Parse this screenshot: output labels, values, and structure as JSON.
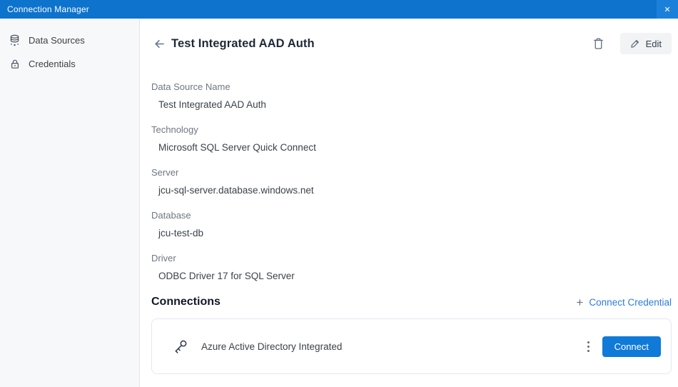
{
  "titlebar": {
    "title": "Connection Manager",
    "close_glyph": "✕"
  },
  "sidebar": {
    "items": [
      {
        "label": "Data Sources",
        "icon": "database-icon"
      },
      {
        "label": "Credentials",
        "icon": "lock-icon"
      }
    ]
  },
  "detail": {
    "title": "Test Integrated AAD Auth",
    "edit_label": "Edit",
    "fields": [
      {
        "label": "Data Source Name",
        "value": "Test Integrated AAD Auth"
      },
      {
        "label": "Technology",
        "value": "Microsoft SQL Server Quick Connect"
      },
      {
        "label": "Server",
        "value": "jcu-sql-server.database.windows.net"
      },
      {
        "label": "Database",
        "value": "jcu-test-db"
      },
      {
        "label": "Driver",
        "value": "ODBC Driver 17 for SQL Server"
      }
    ]
  },
  "connections": {
    "heading": "Connections",
    "add_plus_glyph": "+",
    "add_link_label": "Connect Credential",
    "items": [
      {
        "name": "Azure Active Directory Integrated",
        "action_label": "Connect",
        "icon": "key-icon"
      }
    ]
  },
  "colors": {
    "titlebar_blue": "#0d73cd",
    "button_blue": "#0f7ad8",
    "link_blue": "#2b7de0",
    "sidebar_bg": "#f7f8fa",
    "label_gray": "#6e7781",
    "value_gray": "#3b4249",
    "card_border": "#e3e8ee"
  }
}
